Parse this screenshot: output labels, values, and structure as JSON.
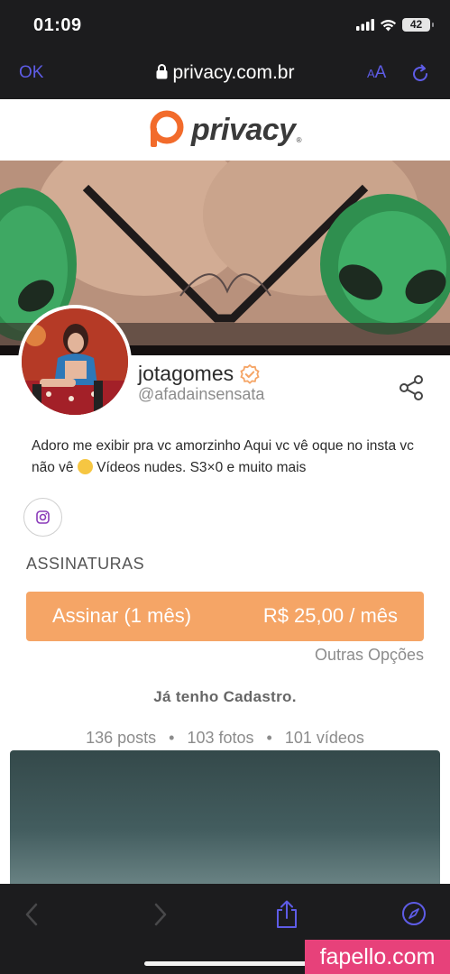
{
  "status_bar": {
    "time": "01:09",
    "battery": "42"
  },
  "browser": {
    "done_label": "OK",
    "url": "privacy.com.br",
    "text_size_label_small": "A",
    "text_size_label_large": "A"
  },
  "header": {
    "logo_text": "privacy",
    "logo_reg": "®"
  },
  "profile": {
    "name": "jotagomes",
    "handle": "@afadainsensata",
    "bio_part1": "Adoro me exibir pra vc amorzinho Aqui vc vê oque no insta vc não vê ",
    "bio_part2": " Vídeos nudes. S3×0 e muito mais"
  },
  "subscriptions": {
    "title": "ASSINATURAS",
    "button_label": "Assinar (1 mês)",
    "button_price": "R$ 25,00 / mês",
    "other_options": "Outras Opções",
    "already_registered": "Já tenho Cadastro."
  },
  "stats": {
    "posts": "136 posts",
    "photos": "103 fotos",
    "videos": "101 vídeos",
    "separator": "•"
  },
  "watermark": "fapello.com",
  "colors": {
    "accent": "#f5a566",
    "browser_tint": "#5e5ce6",
    "verified": "#f5a566",
    "logo_orange": "#f26b2b"
  }
}
